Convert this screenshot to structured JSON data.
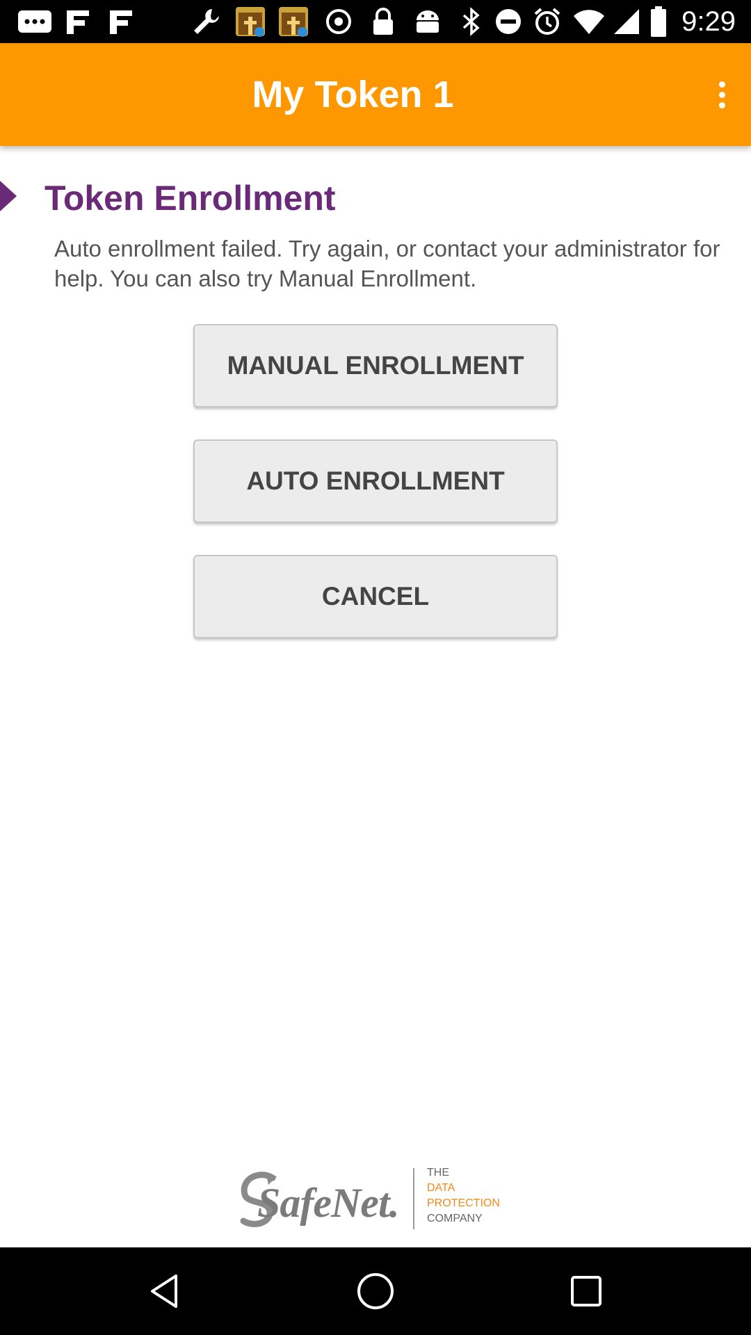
{
  "status_bar": {
    "time": "9:29",
    "icons": [
      "messages-icon",
      "grid-icon",
      "grid-icon",
      "wrench-icon",
      "app-icon",
      "app-icon",
      "circle-dot-icon",
      "lock-icon",
      "android-icon",
      "bluetooth-icon",
      "do-not-disturb-icon",
      "alarm-icon",
      "wifi-icon",
      "signal-icon",
      "battery-icon"
    ]
  },
  "app_bar": {
    "title": "My Token 1",
    "overflow_icon": "more-vert-icon"
  },
  "section": {
    "title": "Token Enrollment",
    "message": "Auto enrollment failed. Try again, or contact your administrator for help. You can also try Manual Enrollment."
  },
  "buttons": {
    "manual": "MANUAL ENROLLMENT",
    "auto": "AUTO ENROLLMENT",
    "cancel": "CANCEL"
  },
  "footer": {
    "brand": "SafeNet.",
    "tagline": [
      "THE",
      "DATA",
      "PROTECTION",
      "COMPANY"
    ]
  },
  "colors": {
    "app_bar": "#FF9800",
    "section_title": "#6B2A78",
    "tagline_accent": "#F08A1C"
  }
}
